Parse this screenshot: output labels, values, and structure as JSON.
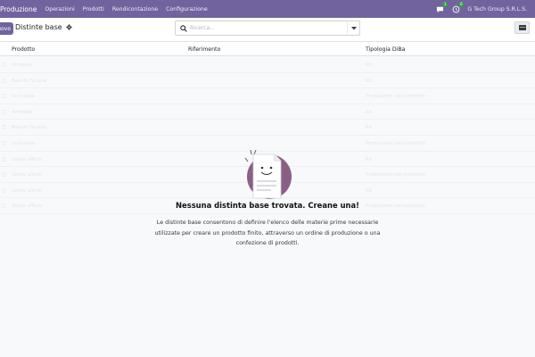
{
  "navbar": {
    "app_name": "Produzione",
    "menus": [
      "Operazioni",
      "Prodotti",
      "Rendicontazione",
      "Configurazione"
    ],
    "chat_badge": "1",
    "activity_badge": "6",
    "company": "G Tech Group S.R.L.S."
  },
  "control": {
    "new_label": "Nuovo",
    "breadcrumb": "Distinte base",
    "search_placeholder": "Ricerca..."
  },
  "list": {
    "columns": [
      "Prodotto",
      "Riferimento",
      "Tipologia DiBa"
    ],
    "ghost_rows": [
      [
        "Armadio",
        "",
        "Kit"
      ],
      [
        "Banchi Scuola",
        "",
        "Kit"
      ],
      [
        "Scrivania",
        "",
        "Produzione del prodotto"
      ],
      [
        "Armadio",
        "",
        "Kit"
      ],
      [
        "Banchi Scuola",
        "",
        "Kit"
      ],
      [
        "Scrivania",
        "",
        "Produzione del prodotto"
      ],
      [
        "Sedia ufficio",
        "",
        "Kit"
      ],
      [
        "Sedia ufficio",
        "",
        "Produzione del prodotto"
      ],
      [
        "Sedia ufficio",
        "",
        "Kit"
      ],
      [
        "Sedia ufficio",
        "",
        "Produzione del prodotto"
      ]
    ]
  },
  "help": {
    "title": "Nessuna distinta base trovata. Creane una!",
    "text": "Le distinte base consentono di definire l'elenco delle materie prime necessarie utilizzate per creare un prodotto finito, attraverso un ordine di produzione o una confezione di prodotti."
  },
  "colors": {
    "brand": "#71639e",
    "badge": "#28a745",
    "background": "#f8f9fa"
  }
}
